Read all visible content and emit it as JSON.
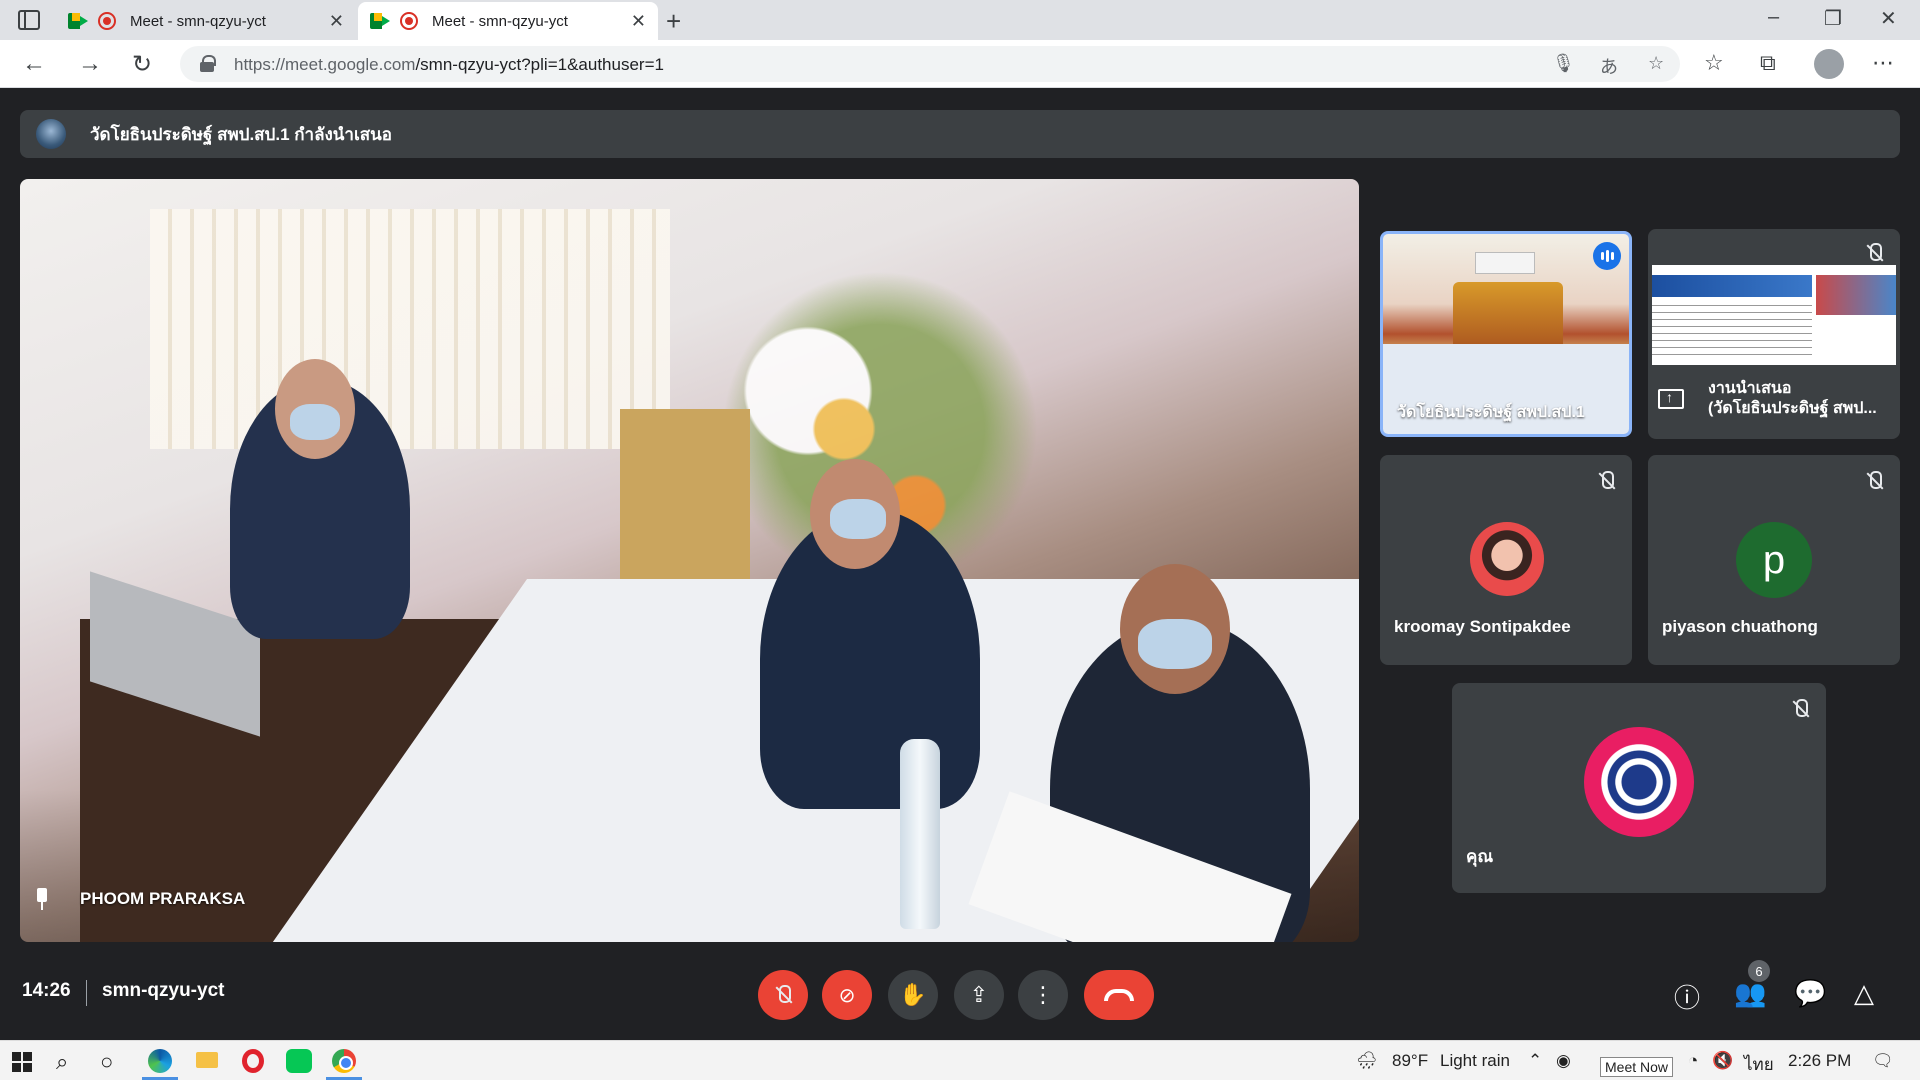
{
  "browser": {
    "tabs": [
      {
        "title": "Meet - smn-qzyu-yct",
        "active": false
      },
      {
        "title": "Meet - smn-qzyu-yct",
        "active": true
      }
    ],
    "url_domain": "https://meet.google.com",
    "url_path": "/smn-qzyu-yct?pli=1&authuser=1"
  },
  "meet": {
    "presenting_banner": "วัดโยธินประดิษฐ์ สพป.สป.1 กำลังนำเสนอ",
    "main_tile_name": "PHOOM PRARAKSA",
    "tiles": [
      {
        "name": "วัดโยธินประดิษฐ์ สพป.สป.1",
        "speaking": true
      },
      {
        "name_line1": "งานนำเสนอ",
        "name_line2": "(วัดโยธินประดิษฐ์ สพป...",
        "muted": true
      },
      {
        "name": "kroomay Sontipakdee",
        "muted": true
      },
      {
        "name": "piyason chuathong",
        "avatar_letter": "p",
        "muted": true
      },
      {
        "name": "คุณ",
        "muted": true
      }
    ],
    "clock": "14:26",
    "meeting_code": "smn-qzyu-yct",
    "participants_count": "6"
  },
  "taskbar": {
    "weather_temp": "89°F",
    "weather_text": "Light rain",
    "language": "ไทย",
    "time": "2:26 PM",
    "tooltip": "Meet Now"
  },
  "colors": {
    "meet_bg": "#202124",
    "tile_bg": "#3c4043",
    "hangup_red": "#ea4335",
    "speaking_blue": "#8ab4f8"
  }
}
